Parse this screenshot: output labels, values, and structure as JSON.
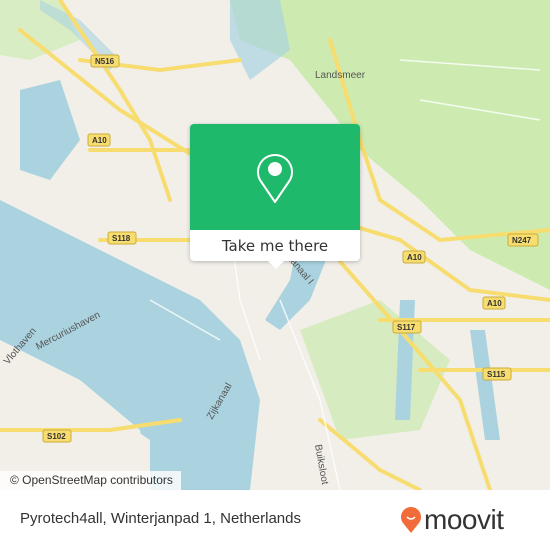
{
  "map": {
    "labels": {
      "landsmeer": "Landsmeer",
      "n516": "N516",
      "a10_west": "A10",
      "a10_east": "A10",
      "a10_south": "A10",
      "s118": "S118",
      "n247": "N247",
      "s117": "S117",
      "s115": "S115",
      "s102": "S102",
      "mercuriushaven": "Mercuriushaven",
      "vlothaven": "Vlothaven",
      "zijkanaal_i": "Zijkanaal I",
      "zijkanaal": "Zijkanaal",
      "buiksloot": "Buiksloot"
    },
    "colors": {
      "land": "#f2efe9",
      "water": "#aad3df",
      "park": "#cdebb0",
      "motorway": "#f7dc6f"
    },
    "attribution": "© OpenStreetMap contributors"
  },
  "popup": {
    "icon": "map-pin-icon",
    "button_label": "Take me there",
    "color": "#1fb96b"
  },
  "footer": {
    "address": "Pyrotech4all, Winterjanpad 1, Netherlands",
    "logo_text": "moovit",
    "logo_color": "#f26b3a"
  }
}
